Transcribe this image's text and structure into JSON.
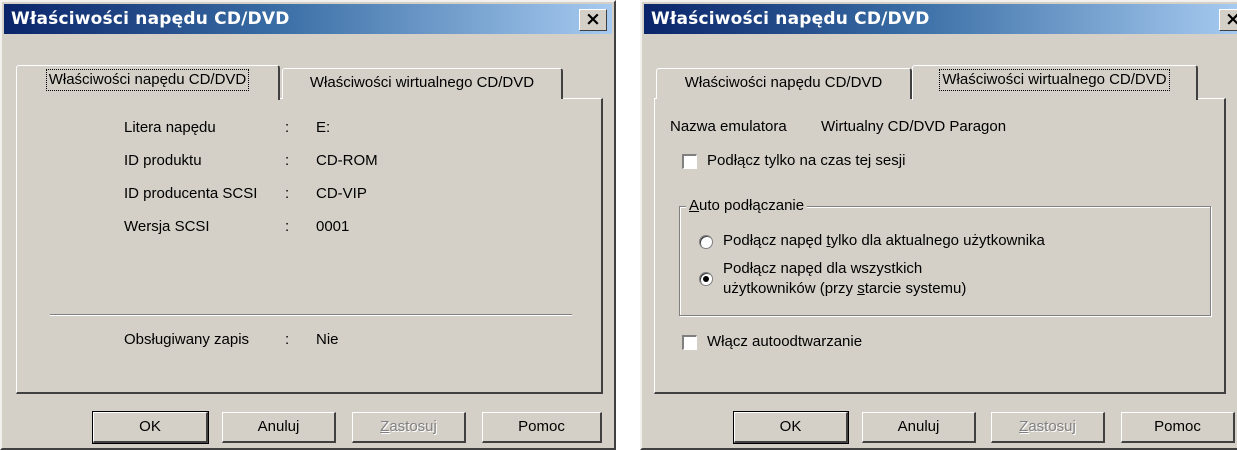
{
  "dialog1": {
    "title": "Właściwości napędu CD/DVD",
    "close_glyph": "×",
    "tabs": [
      {
        "label": "Właściwości napędu CD/DVD"
      },
      {
        "label": "Właściwości wirtualnego CD/DVD"
      }
    ],
    "properties": [
      {
        "label": "Litera napędu",
        "sep": ":",
        "value": "E:"
      },
      {
        "label": "ID produktu",
        "sep": ":",
        "value": "CD-ROM"
      },
      {
        "label": "ID producenta SCSI",
        "sep": ":",
        "value": "CD-VIP"
      },
      {
        "label": "Wersja SCSI",
        "sep": ":",
        "value": "0001"
      }
    ],
    "write_support": {
      "label": "Obsługiwany zapis",
      "sep": ":",
      "value": "Nie"
    },
    "buttons": {
      "ok": "OK",
      "cancel": "Anuluj",
      "apply_pre": "",
      "apply_key": "Z",
      "apply_post": "astosuj",
      "help": "Pomoc"
    }
  },
  "dialog2": {
    "title": "Właściwości napędu CD/DVD",
    "close_glyph": "×",
    "tabs": [
      {
        "label": "Właściwości napędu CD/DVD"
      },
      {
        "label": "Właściwości wirtualnego CD/DVD"
      }
    ],
    "emulator_label": "Nazwa emulatora",
    "emulator_value": "Wirtualny CD/DVD Paragon",
    "session_checkbox": "Podłącz tylko na czas tej sesji",
    "session_checked": false,
    "group": {
      "legend_key": "A",
      "legend_rest": "uto podłączanie",
      "radio1_pre": "Podłącz napęd ",
      "radio1_key": "t",
      "radio1_post": "ylko dla aktualnego użytkownika",
      "radio1_checked": false,
      "radio2_line1": "Podłącz napęd dla wszystkich",
      "radio2_line2_pre": "użytkowników (przy ",
      "radio2_line2_key": "s",
      "radio2_line2_post": "tarcie systemu)",
      "radio2_checked": true
    },
    "autoplay_checkbox": "Włącz autoodtwarzanie",
    "autoplay_checked": false,
    "buttons": {
      "ok": "OK",
      "cancel": "Anuluj",
      "apply_pre": "",
      "apply_key": "Z",
      "apply_post": "astosuj",
      "help": "Pomoc"
    }
  },
  "colors": {
    "face": "#d4d0c8",
    "title_start": "#0a246a",
    "title_end": "#a6caf0",
    "disabled_text": "#808080"
  }
}
